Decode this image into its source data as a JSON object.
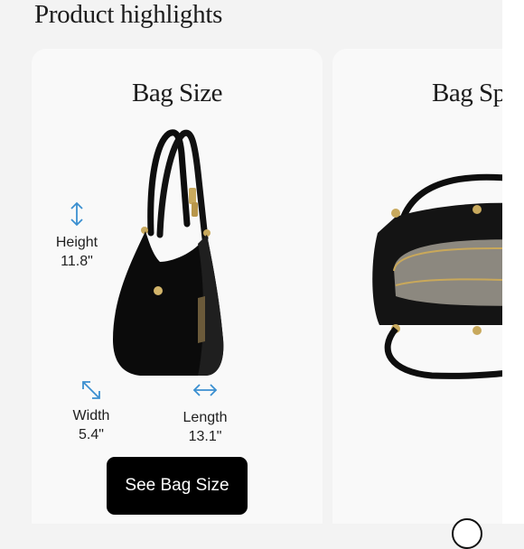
{
  "page": {
    "title": "Product highlights"
  },
  "cards": [
    {
      "title": "Bag Size",
      "height": {
        "label": "Height",
        "value": "11.8\""
      },
      "width": {
        "label": "Width",
        "value": "5.4\""
      },
      "length": {
        "label": "Length",
        "value": "13.1\""
      },
      "button_label": "See Bag Size"
    },
    {
      "title": "Bag Space"
    }
  ],
  "icons": {
    "height": "vertical-arrow-icon",
    "width": "diagonal-arrow-icon",
    "length": "horizontal-arrow-icon"
  },
  "colors": {
    "accent_icon": "#3b8fd0",
    "button_bg": "#000000",
    "button_text": "#ffffff",
    "card_bg": "#f9f9f9",
    "page_bg": "#f3f3f3"
  }
}
